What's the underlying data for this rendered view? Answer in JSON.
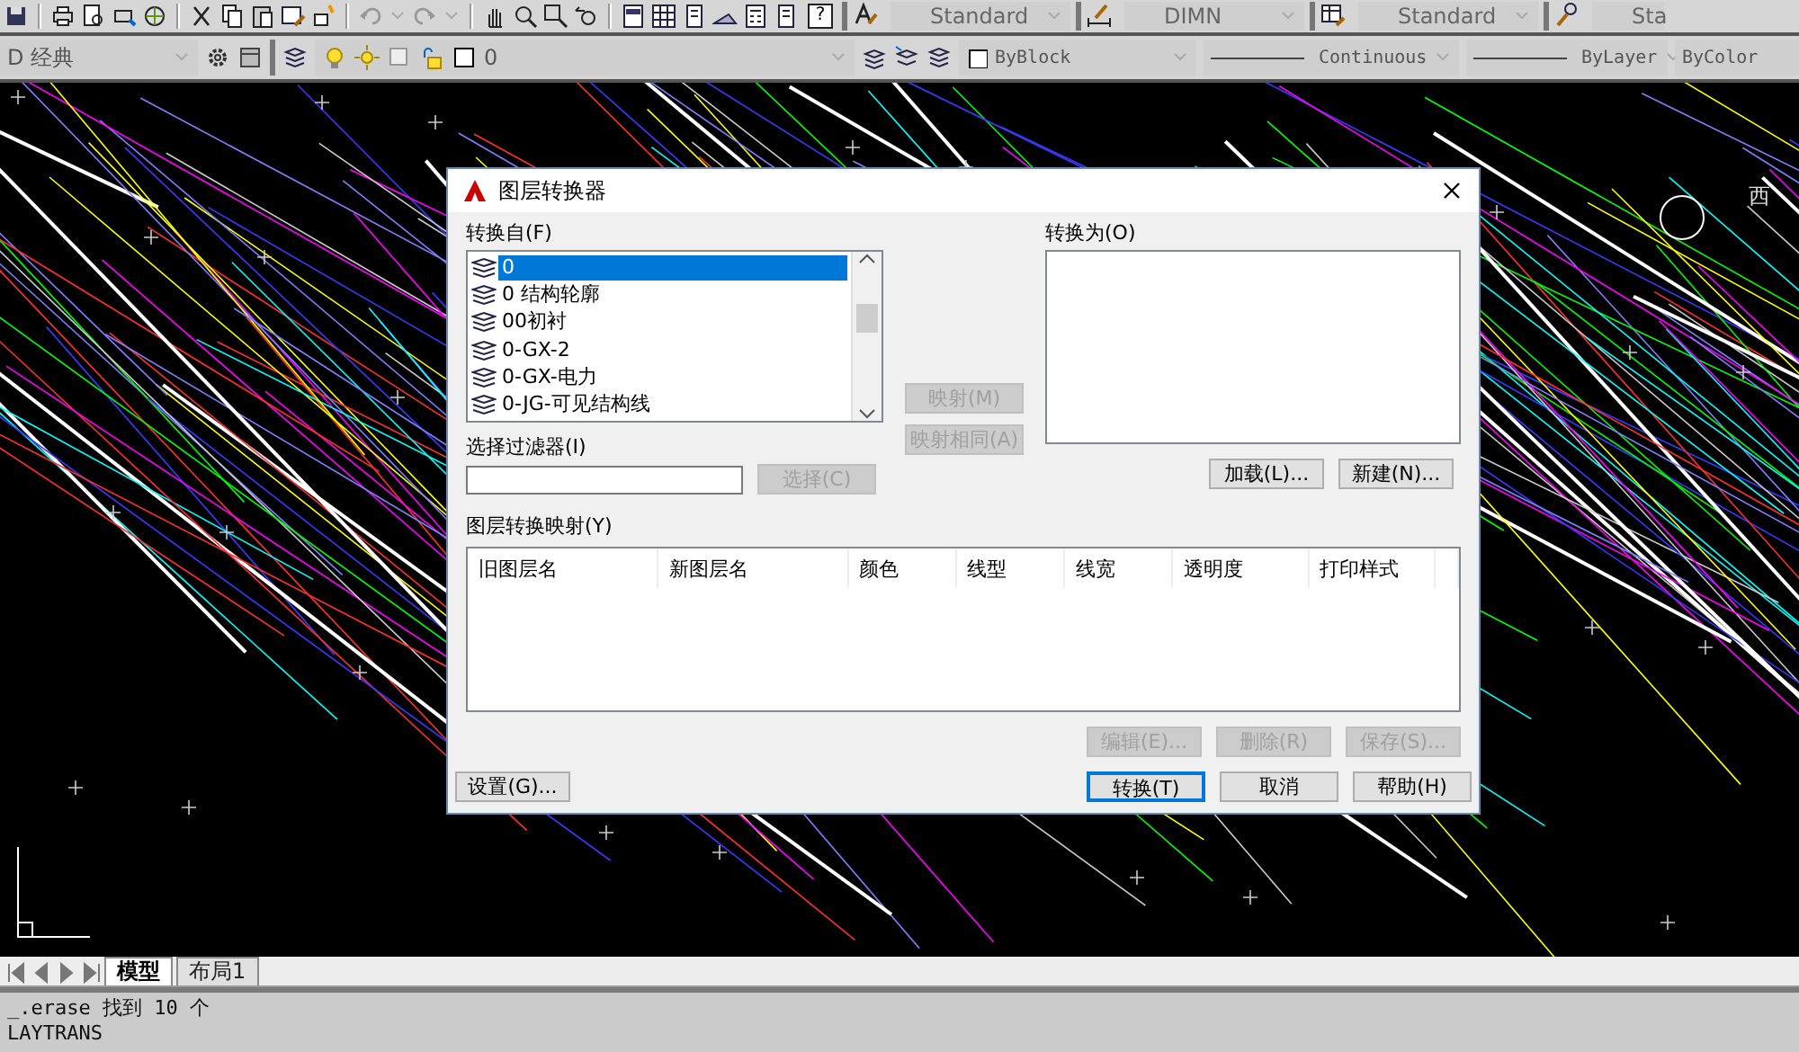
{
  "toolbar_top": {
    "help_key": "?",
    "combos": [
      {
        "value": "Standard"
      },
      {
        "value": "DIMN"
      },
      {
        "value": "Standard"
      },
      {
        "value": "Sta"
      }
    ]
  },
  "toolbar_props": {
    "workspace": "D 经典",
    "layer": "0",
    "color_control": "ByBlock",
    "linetype": "Continuous",
    "lineweight": "ByLayer",
    "plot_style": "ByColor"
  },
  "drawing": {
    "compass_label": "西"
  },
  "dialog": {
    "title": "图层转换器",
    "from_group": {
      "label": "转换自(F)",
      "items": [
        {
          "name": "0",
          "selected": true
        },
        {
          "name": "0 结构轮廓",
          "selected": false
        },
        {
          "name": "00初衬",
          "selected": false
        },
        {
          "name": "0-GX-2",
          "selected": false
        },
        {
          "name": "0-GX-电力",
          "selected": false
        },
        {
          "name": "0-JG-可见结构线",
          "selected": false
        }
      ],
      "filter_label": "选择过滤器(I)",
      "select_button": {
        "label": "选择(C)",
        "disabled": true
      }
    },
    "map_buttons": [
      {
        "label": "映射(M)",
        "disabled": true
      },
      {
        "label": "映射相同(A)",
        "disabled": true
      }
    ],
    "to_group": {
      "label": "转换为(O)",
      "buttons": [
        {
          "label": "加载(L)...",
          "disabled": false
        },
        {
          "label": "新建(N)...",
          "disabled": false
        }
      ]
    },
    "mapping_group": {
      "label": "图层转换映射(Y)",
      "columns": [
        "旧图层名",
        "新图层名",
        "颜色",
        "线型",
        "线宽",
        "透明度",
        "打印样式"
      ],
      "buttons": [
        {
          "label": "编辑(E)...",
          "disabled": true
        },
        {
          "label": "删除(R)",
          "disabled": true
        },
        {
          "label": "保存(S)...",
          "disabled": true
        }
      ]
    },
    "settings_button": {
      "label": "设置(G)...",
      "disabled": false
    },
    "footer_buttons": [
      {
        "label": "转换(T)",
        "disabled": false,
        "default": true
      },
      {
        "label": "取消",
        "disabled": false,
        "default": false
      },
      {
        "label": "帮助(H)",
        "disabled": false,
        "default": false
      }
    ]
  },
  "layout_tabs": [
    {
      "label": "模型",
      "selected": true
    },
    {
      "label": "布局1",
      "selected": false
    }
  ],
  "command_lines": [
    "_.erase 找到 10 个",
    "LAYTRANS"
  ]
}
